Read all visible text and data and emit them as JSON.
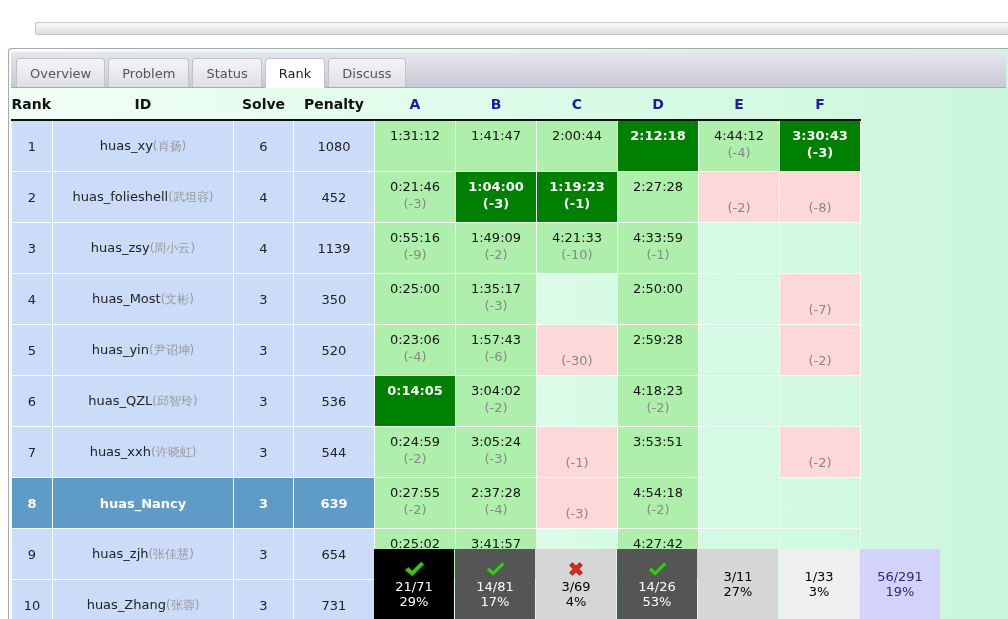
{
  "tabs": [
    {
      "label": "Overview",
      "selected": false
    },
    {
      "label": "Problem",
      "selected": false
    },
    {
      "label": "Status",
      "selected": false
    },
    {
      "label": "Rank",
      "selected": true
    },
    {
      "label": "Discuss",
      "selected": false
    }
  ],
  "table": {
    "columns": [
      "Rank",
      "ID",
      "Solve",
      "Penalty"
    ],
    "problems": [
      "A",
      "B",
      "C",
      "D",
      "E",
      "F"
    ],
    "rows": [
      {
        "rank": "1",
        "id": "huas_xy",
        "name": "(肖扬)",
        "solve": "6",
        "penalty": "1080",
        "selected": false,
        "cells": [
          {
            "kind": "solved",
            "time": "1:31:12"
          },
          {
            "kind": "solved",
            "time": "1:41:47"
          },
          {
            "kind": "solved",
            "time": "2:00:44"
          },
          {
            "kind": "first",
            "time": "2:12:18"
          },
          {
            "kind": "solved",
            "time": "4:44:12",
            "tries": "(-4)"
          },
          {
            "kind": "first",
            "time": "3:30:43",
            "tries": "(-3)"
          }
        ]
      },
      {
        "rank": "2",
        "id": "huas_folieshell",
        "name": "(武坦容)",
        "solve": "4",
        "penalty": "452",
        "selected": false,
        "cells": [
          {
            "kind": "solved",
            "time": "0:21:46",
            "tries": "(-3)"
          },
          {
            "kind": "first",
            "time": "1:04:00",
            "tries": "(-3)"
          },
          {
            "kind": "first",
            "time": "1:19:23",
            "tries": "(-1)"
          },
          {
            "kind": "solved",
            "time": "2:27:28"
          },
          {
            "kind": "failed",
            "tries": "(-2)"
          },
          {
            "kind": "failed",
            "tries": "(-8)"
          }
        ]
      },
      {
        "rank": "3",
        "id": "huas_zsy",
        "name": "(周小云)",
        "solve": "4",
        "penalty": "1139",
        "selected": false,
        "cells": [
          {
            "kind": "solved",
            "time": "0:55:16",
            "tries": "(-9)"
          },
          {
            "kind": "solved",
            "time": "1:49:09",
            "tries": "(-2)"
          },
          {
            "kind": "solved",
            "time": "4:21:33",
            "tries": "(-10)"
          },
          {
            "kind": "solved",
            "time": "4:33:59",
            "tries": "(-1)"
          },
          {
            "kind": "empty"
          },
          {
            "kind": "empty"
          }
        ]
      },
      {
        "rank": "4",
        "id": "huas_Most",
        "name": "(文彬)",
        "solve": "3",
        "penalty": "350",
        "selected": false,
        "cells": [
          {
            "kind": "solved",
            "time": "0:25:00"
          },
          {
            "kind": "solved",
            "time": "1:35:17",
            "tries": "(-3)"
          },
          {
            "kind": "empty"
          },
          {
            "kind": "solved",
            "time": "2:50:00"
          },
          {
            "kind": "empty"
          },
          {
            "kind": "failed",
            "tries": "(-7)"
          }
        ]
      },
      {
        "rank": "5",
        "id": "huas_yin",
        "name": "(尹诏坤)",
        "solve": "3",
        "penalty": "520",
        "selected": false,
        "cells": [
          {
            "kind": "solved",
            "time": "0:23:06",
            "tries": "(-4)"
          },
          {
            "kind": "solved",
            "time": "1:57:43",
            "tries": "(-6)"
          },
          {
            "kind": "failed",
            "tries": "(-30)"
          },
          {
            "kind": "solved",
            "time": "2:59:28"
          },
          {
            "kind": "empty"
          },
          {
            "kind": "failed",
            "tries": "(-2)"
          }
        ]
      },
      {
        "rank": "6",
        "id": "huas_QZL",
        "name": "(邱智玲)",
        "solve": "3",
        "penalty": "536",
        "selected": false,
        "cells": [
          {
            "kind": "first",
            "time": "0:14:05"
          },
          {
            "kind": "solved",
            "time": "3:04:02",
            "tries": "(-2)"
          },
          {
            "kind": "empty"
          },
          {
            "kind": "solved",
            "time": "4:18:23",
            "tries": "(-2)"
          },
          {
            "kind": "empty"
          },
          {
            "kind": "empty"
          }
        ]
      },
      {
        "rank": "7",
        "id": "huas_xxh",
        "name": "(许晓虹)",
        "solve": "3",
        "penalty": "544",
        "selected": false,
        "cells": [
          {
            "kind": "solved",
            "time": "0:24:59",
            "tries": "(-2)"
          },
          {
            "kind": "solved",
            "time": "3:05:24",
            "tries": "(-3)"
          },
          {
            "kind": "failed",
            "tries": "(-1)"
          },
          {
            "kind": "solved",
            "time": "3:53:51"
          },
          {
            "kind": "empty"
          },
          {
            "kind": "failed",
            "tries": "(-2)"
          }
        ]
      },
      {
        "rank": "8",
        "id": "huas_Nancy",
        "solve": "3",
        "penalty": "639",
        "selected": true,
        "cells": [
          {
            "kind": "solved",
            "time": "0:27:55",
            "tries": "(-2)"
          },
          {
            "kind": "solved",
            "time": "2:37:28",
            "tries": "(-4)"
          },
          {
            "kind": "failed",
            "tries": "(-3)"
          },
          {
            "kind": "solved",
            "time": "4:54:18",
            "tries": "(-2)"
          },
          {
            "kind": "empty"
          },
          {
            "kind": "empty"
          }
        ]
      },
      {
        "rank": "9",
        "id": "huas_zjh",
        "name": "(张佳慧)",
        "solve": "3",
        "penalty": "654",
        "selected": false,
        "cells": [
          {
            "kind": "solved",
            "time": "0:25:02"
          },
          {
            "kind": "solved",
            "time": "3:41:57"
          },
          {
            "kind": "empty"
          },
          {
            "kind": "solved",
            "time": "4:27:42"
          },
          {
            "kind": "empty"
          },
          {
            "kind": "empty"
          }
        ]
      },
      {
        "rank": "10",
        "id": "huas_Zhang",
        "name": "(张蓉)",
        "solve": "3",
        "penalty": "731",
        "selected": false
      }
    ],
    "summary": [
      {
        "kind": "check",
        "ratio": "21/71",
        "percent": "29%",
        "color": "#000000"
      },
      {
        "kind": "check",
        "ratio": "14/81",
        "percent": "17%",
        "color": "#555555"
      },
      {
        "kind": "cross",
        "ratio": "3/69",
        "percent": "4%",
        "color": "#d6d6d6"
      },
      {
        "kind": "check",
        "ratio": "14/26",
        "percent": "53%",
        "color": "#555555"
      },
      {
        "kind": "none",
        "ratio": "3/11",
        "percent": "27%",
        "color": "#d6d6d6"
      },
      {
        "kind": "none",
        "ratio": "1/33",
        "percent": "3%",
        "color": "#efefef"
      },
      {
        "kind": "none",
        "ratio": "56/291",
        "percent": "19%",
        "color": "#d2d2fa"
      }
    ]
  }
}
